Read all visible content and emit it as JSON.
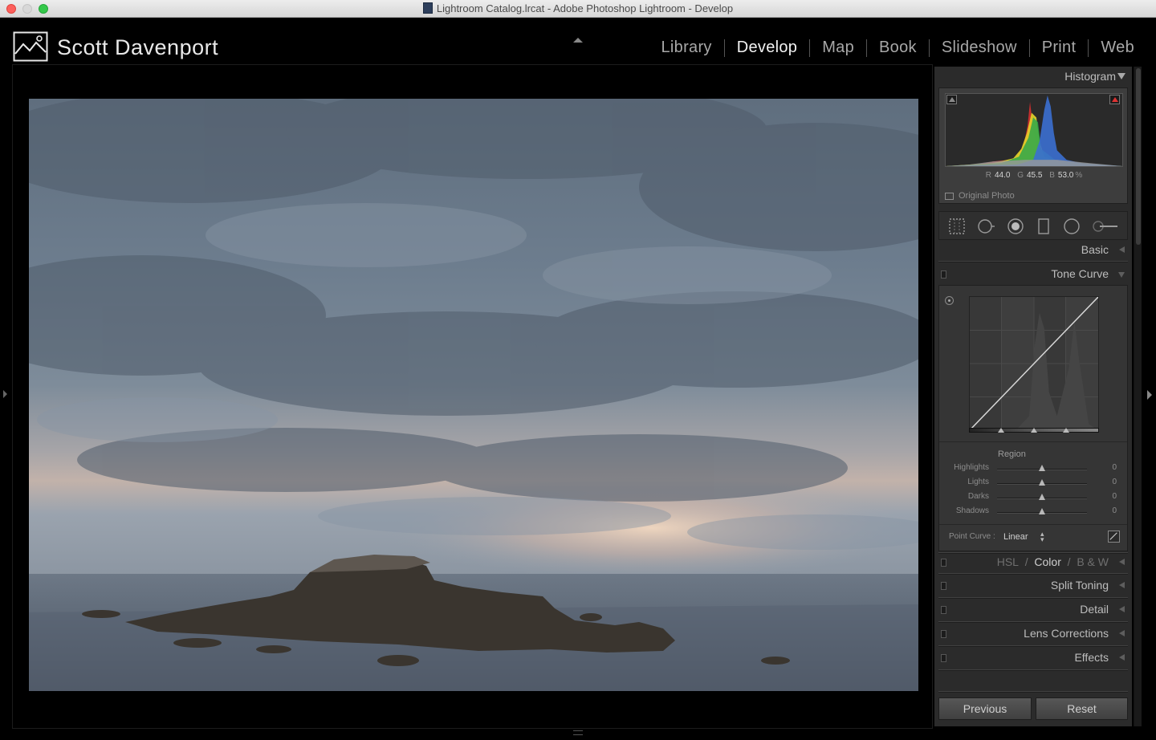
{
  "window": {
    "title": "Lightroom Catalog.lrcat - Adobe Photoshop Lightroom - Develop"
  },
  "identity_plate": "Scott Davenport",
  "modules": [
    {
      "label": "Library",
      "active": false
    },
    {
      "label": "Develop",
      "active": true
    },
    {
      "label": "Map",
      "active": false
    },
    {
      "label": "Book",
      "active": false
    },
    {
      "label": "Slideshow",
      "active": false
    },
    {
      "label": "Print",
      "active": false
    },
    {
      "label": "Web",
      "active": false
    }
  ],
  "histogram": {
    "title": "Histogram",
    "r_label": "R",
    "r_value": "44.0",
    "g_label": "G",
    "g_value": "45.5",
    "b_label": "B",
    "b_value": "53.0",
    "unit": "%",
    "original_photo_label": "Original Photo"
  },
  "tools": [
    "crop-overlay-icon",
    "spot-removal-icon",
    "red-eye-icon",
    "graduated-filter-icon",
    "radial-filter-icon",
    "adjustment-brush-icon"
  ],
  "panels": {
    "basic": "Basic",
    "tone_curve": "Tone Curve",
    "region_label": "Region",
    "sliders": [
      {
        "label": "Highlights",
        "value": "0"
      },
      {
        "label": "Lights",
        "value": "0"
      },
      {
        "label": "Darks",
        "value": "0"
      },
      {
        "label": "Shadows",
        "value": "0"
      }
    ],
    "point_curve_label": "Point Curve :",
    "point_curve_value": "Linear",
    "hsl": "HSL",
    "hsl_sep1": "/",
    "color": "Color",
    "hsl_sep2": "/",
    "bw": "B & W",
    "split_toning": "Split Toning",
    "detail": "Detail",
    "lens_corrections": "Lens Corrections",
    "effects": "Effects"
  },
  "buttons": {
    "previous": "Previous",
    "reset": "Reset"
  },
  "colors": {
    "accent_active": "#f2f2f2",
    "panel_bg": "#2b2b2b",
    "clip_highlight": "#dd3333"
  }
}
